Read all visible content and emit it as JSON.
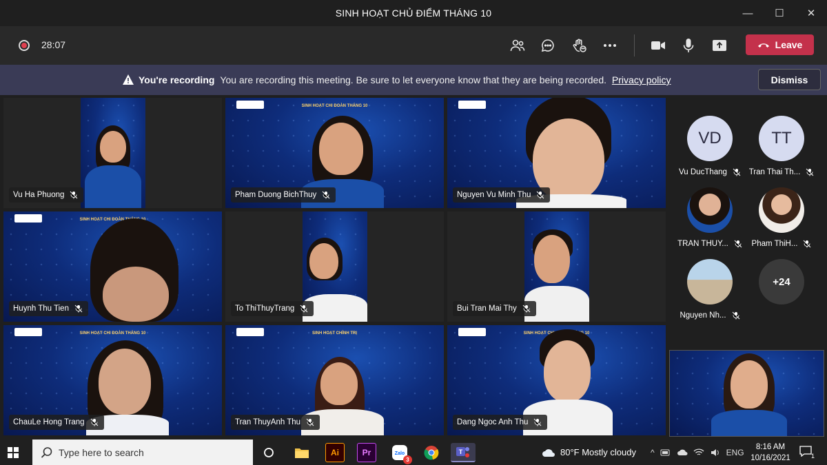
{
  "window": {
    "title": "SINH HOẠT CHỦ ĐIỂM THÁNG 10",
    "minimize": "—",
    "maximize": "☐",
    "close": "✕"
  },
  "toolbar": {
    "timer": "28:07",
    "leave_label": "Leave"
  },
  "banner": {
    "title": "You're recording",
    "message": "You are recording this meeting. Be sure to let everyone know that they are being recorded.",
    "link": "Privacy policy",
    "dismiss": "Dismiss"
  },
  "participants": [
    {
      "name": "Vu Ha Phuong"
    },
    {
      "name": "Pham Duong BichThuy"
    },
    {
      "name": "Nguyen Vu Minh Thu"
    },
    {
      "name": "Huynh Thu Tien"
    },
    {
      "name": "To ThiThuyTrang"
    },
    {
      "name": "Bui Tran Mai Thy"
    },
    {
      "name": "ChauLe Hong Trang"
    },
    {
      "name": "Tran ThuyAnh Thu"
    },
    {
      "name": "Dang Ngoc Anh Thu"
    }
  ],
  "slides": {
    "s1": "SINH HOẠT CHI ĐOÀN THÁNG 10",
    "s2": "SINH HOẠT CHÍNH TRỊ"
  },
  "roster": [
    {
      "initials": "VD",
      "name": "Vu DucThang"
    },
    {
      "initials": "TT",
      "name": "Tran Thai Th..."
    },
    {
      "initials": "",
      "name": "TRAN THUY..."
    },
    {
      "initials": "",
      "name": "Pham ThiH..."
    },
    {
      "initials": "",
      "name": "Nguyen Nh..."
    },
    {
      "initials": "+24",
      "name": ""
    }
  ],
  "taskbar": {
    "search_placeholder": "Type here to search",
    "weather": "80°F  Mostly cloudy",
    "lang": "ENG",
    "time": "8:16 AM",
    "date": "10/16/2021",
    "notif_count": "1",
    "zalo_badge": "3",
    "apps": [
      "Ai",
      "Pr"
    ]
  },
  "colors": {
    "leave": "#c4314b",
    "banner": "#3a3b56",
    "toolbar": "#292929",
    "background": "#1f1f1f"
  }
}
